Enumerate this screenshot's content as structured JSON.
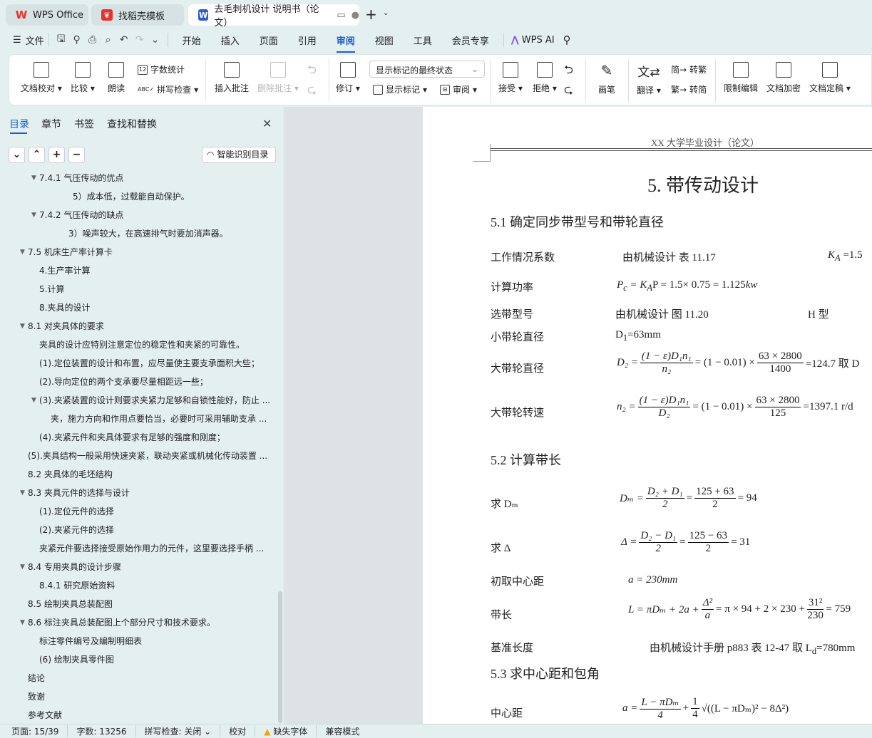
{
  "tabs": [
    {
      "label": "WPS Office",
      "icon": "wps-logo-icon"
    },
    {
      "label": "找稻壳模板",
      "icon": "docer-icon"
    },
    {
      "label": "去毛刺机设计 说明书（论文）",
      "icon": "wps-writer-icon"
    }
  ],
  "menu": {
    "file": "文件",
    "items": [
      "开始",
      "插入",
      "页面",
      "引用",
      "审阅",
      "视图",
      "工具",
      "会员专享"
    ],
    "active": "审阅",
    "ai": "WPS AI"
  },
  "ribbon": {
    "proofread": "文档校对",
    "compare": "比较",
    "read": "朗读",
    "wordcount": "字数统计",
    "spell": "拼写检查",
    "insert_comment": "插入批注",
    "delete_comment": "删除批注",
    "revise": "修订",
    "markup_combo": "显示标记的最终状态",
    "show_markup": "显示标记",
    "review": "审阅",
    "accept": "接受",
    "reject": "拒绝",
    "pen": "画笔",
    "translate": "翻译",
    "to_trad": "转繁",
    "to_simp": "转简",
    "restrict": "限制编辑",
    "encrypt": "文档加密",
    "finalize": "文档定稿"
  },
  "sidebar": {
    "tabs": [
      "目录",
      "章节",
      "书签",
      "查找和替换"
    ],
    "active_tab": "目录",
    "smart_toc": "智能识别目录",
    "items": [
      {
        "text": "7.4.1  气压传动的优点",
        "level": 2,
        "arrow": true
      },
      {
        "text": "5）成本低，过载能自动保护。",
        "level": 5,
        "arrow": false
      },
      {
        "text": "7.4.2 气压传动的缺点",
        "level": 2,
        "arrow": true
      },
      {
        "text": "3）噪声较大，在高速排气时要加消声器。",
        "level": 4,
        "arrow": false
      },
      {
        "text": "7.5 机床生产率计算卡",
        "level": 1,
        "arrow": true
      },
      {
        "text": "4.生产率计算",
        "level": 2,
        "arrow": false
      },
      {
        "text": "5.计算",
        "level": 2,
        "arrow": false
      },
      {
        "text": "8.夹具的设计",
        "level": 2,
        "arrow": false
      },
      {
        "text": "8.1  对夹具体的要求",
        "level": 1,
        "arrow": true
      },
      {
        "text": "夹具的设计应特别注意定位的稳定性和夹紧的可靠性。",
        "level": 2,
        "arrow": false
      },
      {
        "text": "(1).定位装置的设计和布置，应尽量使主要支承面积大些；",
        "level": 2,
        "arrow": false
      },
      {
        "text": "(2).导向定位的两个支承要尽量相距远一些；",
        "level": 2,
        "arrow": false
      },
      {
        "text": "(3).夹紧装置的设计则要求夹紧力足够和自锁性能好，防止 ...",
        "level": 2,
        "arrow": true
      },
      {
        "text": "夹，施力方向和作用点要恰当，必要时可采用辅助支承 ...",
        "level": 3,
        "arrow": false
      },
      {
        "text": "(4).夹紧元件和夹具体要求有足够的强度和刚度；",
        "level": 2,
        "arrow": false
      },
      {
        "text": "(5).夹具结构一般采用快速夹紧，联动夹紧或机械化传动装置 ...",
        "level": 1,
        "arrow": false
      },
      {
        "text": "8.2  夹具体的毛坯结构",
        "level": 1,
        "arrow": false
      },
      {
        "text": "8.3 夹具元件的选择与设计",
        "level": 1,
        "arrow": true
      },
      {
        "text": "(1).定位元件的选择",
        "level": 2,
        "arrow": false
      },
      {
        "text": " (2).夹紧元件的选择",
        "level": 2,
        "arrow": false
      },
      {
        "text": "  夹紧元件要选择接受原始作用力的元件，这里要选择手柄 ...",
        "level": 2,
        "arrow": false
      },
      {
        "text": "8.4  专用夹具的设计步骤",
        "level": 1,
        "arrow": true
      },
      {
        "text": "8.4.1  研究原始资料",
        "level": 2,
        "arrow": false
      },
      {
        "text": "8.5  绘制夹具总装配图",
        "level": 1,
        "arrow": false
      },
      {
        "text": "8.6  标注夹具总装配图上个部分尺寸和技术要求。",
        "level": 1,
        "arrow": true
      },
      {
        "text": "标注零件编号及编制明细表",
        "level": 2,
        "arrow": false
      },
      {
        "text": "(6)  绘制夹具零件图",
        "level": 2,
        "arrow": false
      },
      {
        "text": "结论",
        "level": 1,
        "arrow": false
      },
      {
        "text": "致谢",
        "level": 1,
        "arrow": false
      },
      {
        "text": "参考文献",
        "level": 1,
        "arrow": false
      }
    ]
  },
  "doc": {
    "header": "XX 大学毕业设计（论文）",
    "chapter": "5.  带传动设计",
    "s51": "5.1  确定同步带型号和带轮直径",
    "r1": {
      "label": "工作情况系数",
      "src": "由机械设计  表 11.17",
      "val": "K",
      "sub": "A",
      "eq": " =1.5"
    },
    "r2": {
      "label": "计算功率",
      "formula": "P",
      "f2": "c",
      "f3": " = K",
      "f4": "A",
      "f5": "P = 1.5× 0.75 = 1.125",
      "f6": "kw"
    },
    "r3": {
      "label": "选带型号",
      "src": "由机械设计  图 11.20",
      "type": "H 型"
    },
    "r4": {
      "label": "小带轮直径",
      "val": "D",
      "sub": "1",
      "eq": "=63mm"
    },
    "r5": {
      "label": "大带轮直径",
      "lhs": "D₂ =",
      "num": "(1 − ε)D₁n₁",
      "den": "n₂",
      "mid": "= (1 − 0.01) ×",
      "num2": "63 × 2800",
      "den2": "1400",
      "rhs": "=124.7    取 D"
    },
    "r6": {
      "label": "大带轮转速",
      "lhs": "n₂ =",
      "num": "(1 − ε)D₁n₁",
      "den": "D₂",
      "mid": "= (1 − 0.01) ×",
      "num2": "63 × 2800",
      "den2": "125",
      "rhs": "=1397.1 r/d"
    },
    "s52": "5.2  计算带长",
    "r7": {
      "label": "求 Dₘ",
      "lhs": "Dₘ =",
      "num": "D₂ + D₁",
      "den": "2",
      "mid": "=",
      "num2": "125 + 63",
      "den2": "2",
      "rhs": "= 94"
    },
    "r8": {
      "label": "求 Δ",
      "lhs": "Δ =",
      "num": "D₂ − D₁",
      "den": "2",
      "mid": "=",
      "num2": "125 − 63",
      "den2": "2",
      "rhs": "= 31"
    },
    "r9": {
      "label": "初取中心距",
      "formula": "a = 230mm"
    },
    "r10": {
      "label": "带长",
      "lhs": "L = πDₘ + 2a +",
      "num": "Δ²",
      "den": "a",
      "mid": "= π × 94 + 2 × 230 +",
      "num2": "31²",
      "den2": "230",
      "rhs": "= 759"
    },
    "r11": {
      "label": "基准长度",
      "src": "由机械设计手册 p883 表 12-47 取 L",
      "sub": "d",
      "eq": "=780mm"
    },
    "s53": "5.3  求中心距和包角",
    "r12": {
      "label": "中心距",
      "lhs": "a =",
      "num": "L − πDₘ",
      "den": "4",
      "mid": "+",
      "num2": "1",
      "den2": "4",
      "rhs": "√((L − πDₘ)² − 8Δ²)"
    }
  },
  "status": {
    "page": "页面: 15/39",
    "words": "字数: 13256",
    "spell": "拼写检查: 关闭",
    "proof": "校对",
    "font": "缺失字体",
    "compat": "兼容模式"
  },
  "colors": {
    "accent": "#1a5fd0",
    "wps_red": "#e8322b",
    "warning": "#f0a500"
  }
}
